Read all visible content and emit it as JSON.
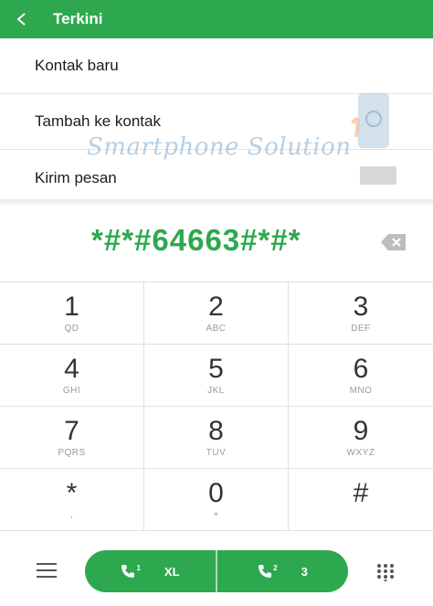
{
  "header": {
    "title": "Terkini"
  },
  "menu": {
    "items": [
      "Kontak baru",
      "Tambah ke kontak",
      "Kirim pesan"
    ]
  },
  "watermark": {
    "text": "Smartphone Solution"
  },
  "dial": {
    "number": "*#*#64663#*#*"
  },
  "keys": [
    {
      "digit": "1",
      "letters": "QD"
    },
    {
      "digit": "2",
      "letters": "ABC"
    },
    {
      "digit": "3",
      "letters": "DEF"
    },
    {
      "digit": "4",
      "letters": "GHI"
    },
    {
      "digit": "5",
      "letters": "JKL"
    },
    {
      "digit": "6",
      "letters": "MNO"
    },
    {
      "digit": "7",
      "letters": "PQRS"
    },
    {
      "digit": "8",
      "letters": "TUV"
    },
    {
      "digit": "9",
      "letters": "WXYZ"
    },
    {
      "digit": "*",
      "letters": ","
    },
    {
      "digit": "0",
      "letters": "+"
    },
    {
      "digit": "#",
      "letters": ""
    }
  ],
  "call": {
    "sim1_label": "XL",
    "sim1_index": "1",
    "sim2_label": "3",
    "sim2_index": "2"
  },
  "colors": {
    "accent": "#2ea84f"
  }
}
